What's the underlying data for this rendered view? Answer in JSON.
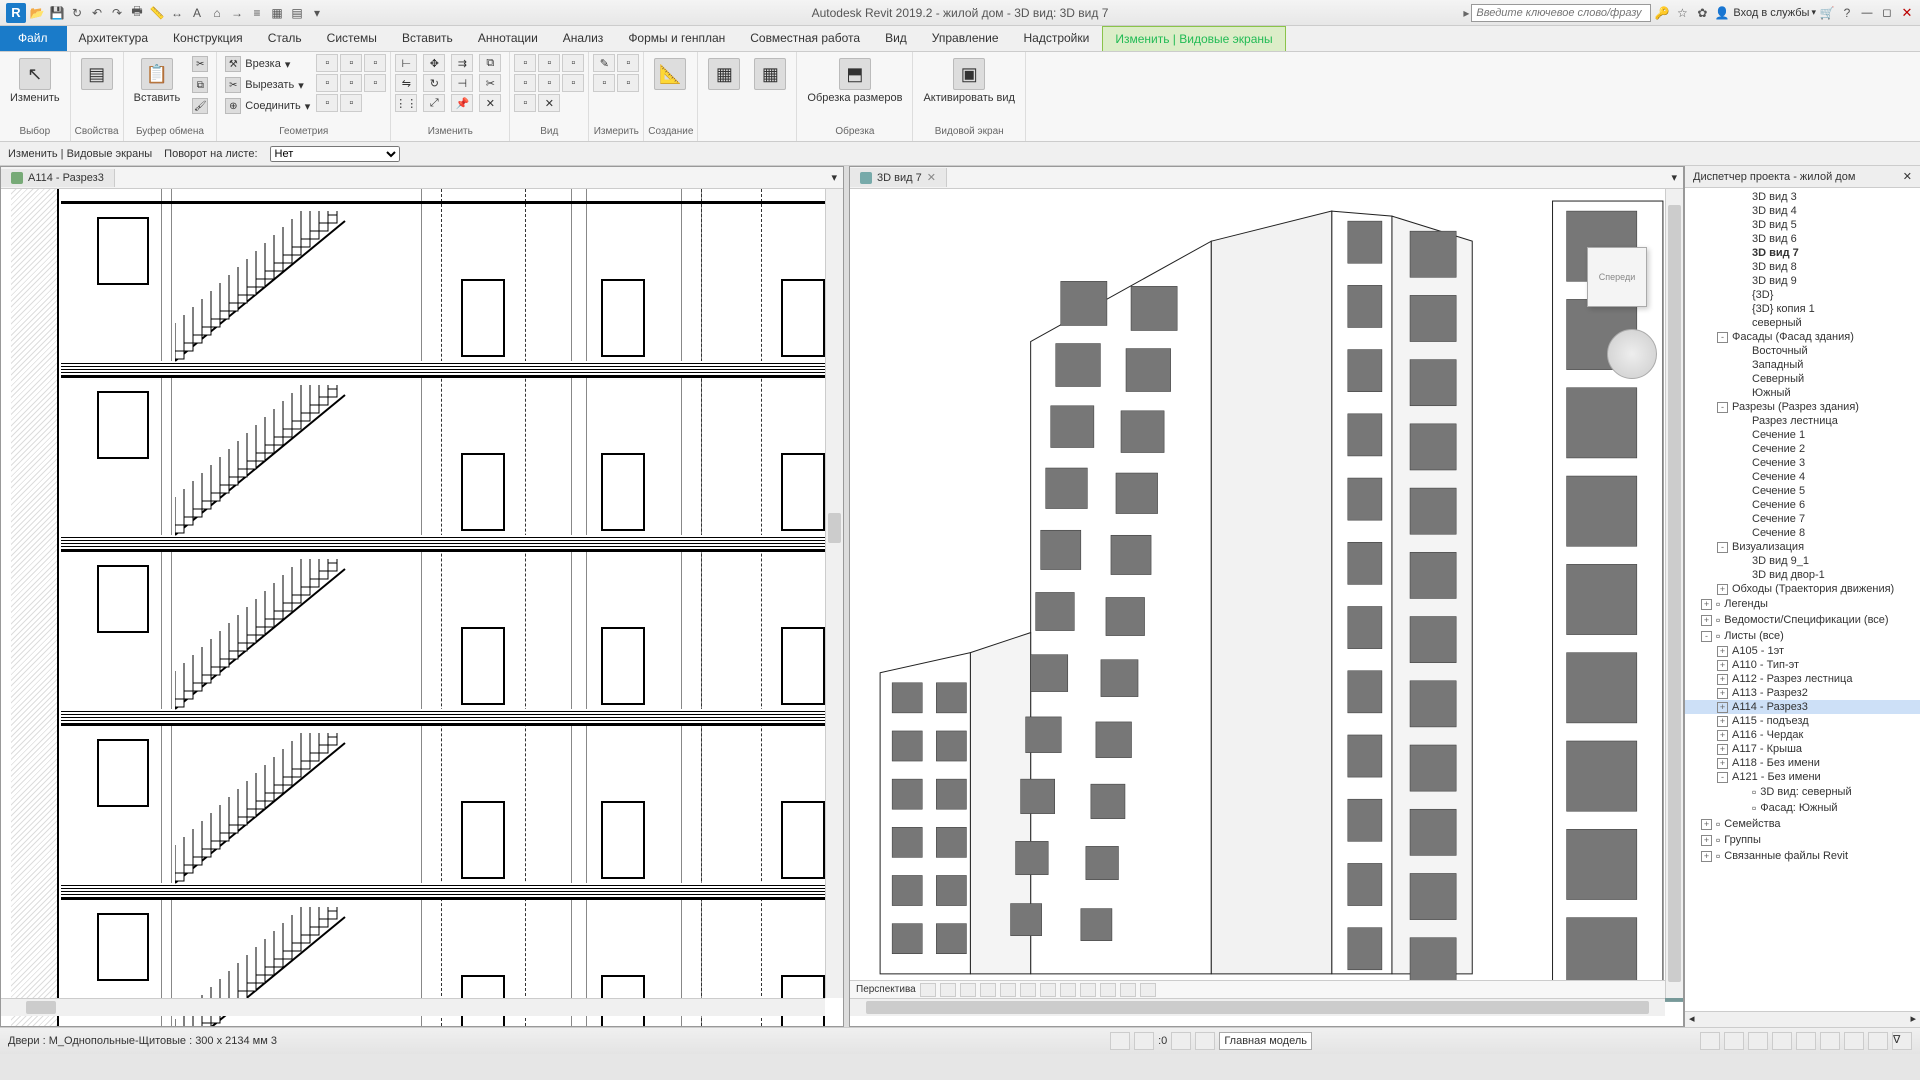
{
  "title": "Autodesk Revit 2019.2 - жилой дом - 3D вид: 3D вид 7",
  "search_placeholder": "Введите ключевое слово/фразу",
  "user_label": "Вход в службы",
  "ribbon_tabs": [
    "Файл",
    "Архитектура",
    "Конструкция",
    "Сталь",
    "Системы",
    "Вставить",
    "Аннотации",
    "Анализ",
    "Формы и генплан",
    "Совместная работа",
    "Вид",
    "Управление",
    "Надстройки",
    "Изменить | Видовые экраны"
  ],
  "active_tab_index": 13,
  "ribbon": {
    "select": {
      "btn": "Изменить",
      "label": "Выбор"
    },
    "props": {
      "label": "Свойства"
    },
    "clipboard": {
      "paste": "Вставить",
      "label": "Буфер обмена"
    },
    "geometry": {
      "cut": "Врезка",
      "trim": "Вырезать",
      "join": "Соединить",
      "label": "Геометрия"
    },
    "modify": {
      "label": "Изменить"
    },
    "view": {
      "label": "Вид"
    },
    "measure": {
      "label": "Измерить"
    },
    "create": {
      "label": "Создание"
    },
    "crop": {
      "btn": "Обрезка размеров",
      "label": "Обрезка"
    },
    "viewport": {
      "btn": "Активировать вид",
      "label": "Видовой экран"
    }
  },
  "options": {
    "context": "Изменить | Видовые экраны",
    "rotate_label": "Поворот на листе:",
    "rotate_value": "Нет"
  },
  "left_view": {
    "tab": "A114 - Разрез3"
  },
  "right_view": {
    "tab": "3D вид 7",
    "controls_label": "Перспектива",
    "viewcube": "Спереди"
  },
  "project_browser": {
    "title": "Диспетчер проекта - жилой дом",
    "items": [
      {
        "label": "3D вид 3",
        "indent": 52
      },
      {
        "label": "3D вид 4",
        "indent": 52
      },
      {
        "label": "3D вид 5",
        "indent": 52
      },
      {
        "label": "3D вид 6",
        "indent": 52
      },
      {
        "label": "3D вид 7",
        "indent": 52,
        "bold": true
      },
      {
        "label": "3D вид 8",
        "indent": 52
      },
      {
        "label": "3D вид 9",
        "indent": 52
      },
      {
        "label": "{3D}",
        "indent": 52
      },
      {
        "label": "{3D} копия 1",
        "indent": 52
      },
      {
        "label": "северный",
        "indent": 52
      },
      {
        "label": "Фасады (Фасад здания)",
        "indent": 32,
        "exp": "-"
      },
      {
        "label": "Восточный",
        "indent": 52
      },
      {
        "label": "Западный",
        "indent": 52
      },
      {
        "label": "Северный",
        "indent": 52
      },
      {
        "label": "Южный",
        "indent": 52
      },
      {
        "label": "Разрезы (Разрез здания)",
        "indent": 32,
        "exp": "-"
      },
      {
        "label": "Разрез лестница",
        "indent": 52
      },
      {
        "label": "Сечение 1",
        "indent": 52
      },
      {
        "label": "Сечение 2",
        "indent": 52
      },
      {
        "label": "Сечение 3",
        "indent": 52
      },
      {
        "label": "Сечение 4",
        "indent": 52
      },
      {
        "label": "Сечение 5",
        "indent": 52
      },
      {
        "label": "Сечение 6",
        "indent": 52
      },
      {
        "label": "Сечение 7",
        "indent": 52
      },
      {
        "label": "Сечение 8",
        "indent": 52
      },
      {
        "label": "Визуализация",
        "indent": 32,
        "exp": "-"
      },
      {
        "label": "3D вид 9_1",
        "indent": 52
      },
      {
        "label": "3D вид двор-1",
        "indent": 52
      },
      {
        "label": "Обходы (Траектория движения)",
        "indent": 32,
        "exp": "+"
      },
      {
        "label": "Легенды",
        "indent": 16,
        "exp": "+",
        "icon": true
      },
      {
        "label": "Ведомости/Спецификации (все)",
        "indent": 16,
        "exp": "+",
        "icon": true
      },
      {
        "label": "Листы (все)",
        "indent": 16,
        "exp": "-",
        "icon": true
      },
      {
        "label": "A105 - 1эт",
        "indent": 32,
        "exp": "+"
      },
      {
        "label": "A110 - Тип-эт",
        "indent": 32,
        "exp": "+"
      },
      {
        "label": "A112 - Разрез лестница",
        "indent": 32,
        "exp": "+"
      },
      {
        "label": "A113 - Разрез2",
        "indent": 32,
        "exp": "+"
      },
      {
        "label": "A114 - Разрез3",
        "indent": 32,
        "exp": "+",
        "selected": true
      },
      {
        "label": "A115 - подъезд",
        "indent": 32,
        "exp": "+"
      },
      {
        "label": "A116 - Чердак",
        "indent": 32,
        "exp": "+"
      },
      {
        "label": "A117 - Крыша",
        "indent": 32,
        "exp": "+"
      },
      {
        "label": "A118 - Без имени",
        "indent": 32,
        "exp": "+"
      },
      {
        "label": "A121 - Без имени",
        "indent": 32,
        "exp": "-"
      },
      {
        "label": "3D вид: северный",
        "indent": 52,
        "icon": true
      },
      {
        "label": "Фасад: Южный",
        "indent": 52,
        "icon": true
      },
      {
        "label": "Семейства",
        "indent": 16,
        "exp": "+",
        "icon": true
      },
      {
        "label": "Группы",
        "indent": 16,
        "exp": "+",
        "icon": true
      },
      {
        "label": "Связанные файлы Revit",
        "indent": 16,
        "exp": "+",
        "icon": true
      }
    ]
  },
  "status": {
    "left": "Двери : М_Однопольные-Щитовые : 300 x 2134 мм 3",
    "zero": ":0",
    "model": "Главная модель"
  }
}
